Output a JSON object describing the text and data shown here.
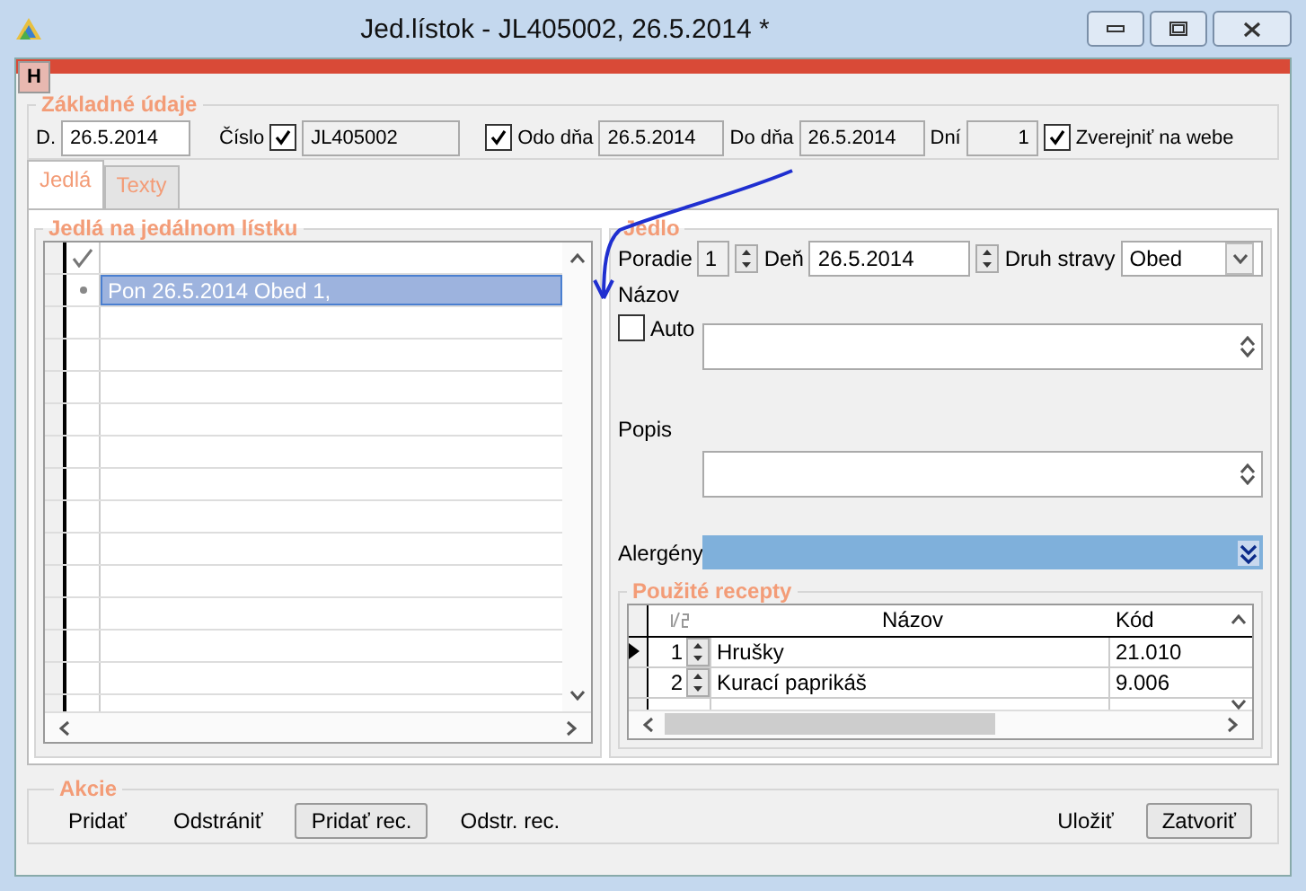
{
  "window": {
    "title": "Jed.lístok - JL405002, 26.5.2014 *"
  },
  "header_tab": "H",
  "basic": {
    "title": "Základné údaje",
    "date_label": "D.",
    "date_value": "26.5.2014",
    "number_label": "Číslo",
    "number_checked": true,
    "number_value": "JL405002",
    "from_checked": true,
    "from_label": "Odo dňa",
    "from_value": "26.5.2014",
    "to_label": "Do dňa",
    "to_value": "26.5.2014",
    "days_label": "Dní",
    "days_value": "1",
    "publish_checked": true,
    "publish_label": "Zverejniť na webe"
  },
  "tabs": [
    {
      "label": "Jedlá",
      "selected": true
    },
    {
      "label": "Texty",
      "selected": false
    }
  ],
  "meals": {
    "title": "Jedlá na jedálnom lístku",
    "rows": [
      {
        "text": "Pon 26.5.2014 Obed 1,",
        "selected": true
      }
    ]
  },
  "dish": {
    "title": "Jedlo",
    "order_label": "Poradie",
    "order_value": "1",
    "day_label": "Deň",
    "day_value": "26.5.2014",
    "type_label": "Druh stravy",
    "type_value": "Obed",
    "name_label": "Názov",
    "auto_label": "Auto",
    "auto_checked": false,
    "desc_label": "Popis",
    "allergens_label": "Alergény"
  },
  "recipes": {
    "title": "Použité recepty",
    "columns": [
      "Názov",
      "Kód"
    ],
    "rows": [
      {
        "order": "1",
        "name": "Hrušky",
        "code": "21.010",
        "selected": true
      },
      {
        "order": "2",
        "name": "Kurací paprikáš",
        "code": "9.006",
        "selected": false
      }
    ]
  },
  "actions": {
    "title": "Akcie",
    "left_buttons": [
      {
        "label": "Pridať",
        "kind": "link"
      },
      {
        "label": "Odstrániť",
        "kind": "link"
      },
      {
        "label": "Pridať rec.",
        "kind": "button"
      },
      {
        "label": "Odstr. rec.",
        "kind": "link"
      }
    ],
    "right_buttons": [
      {
        "label": "Uložiť",
        "kind": "link"
      },
      {
        "label": "Zatvoriť",
        "kind": "button"
      }
    ]
  }
}
